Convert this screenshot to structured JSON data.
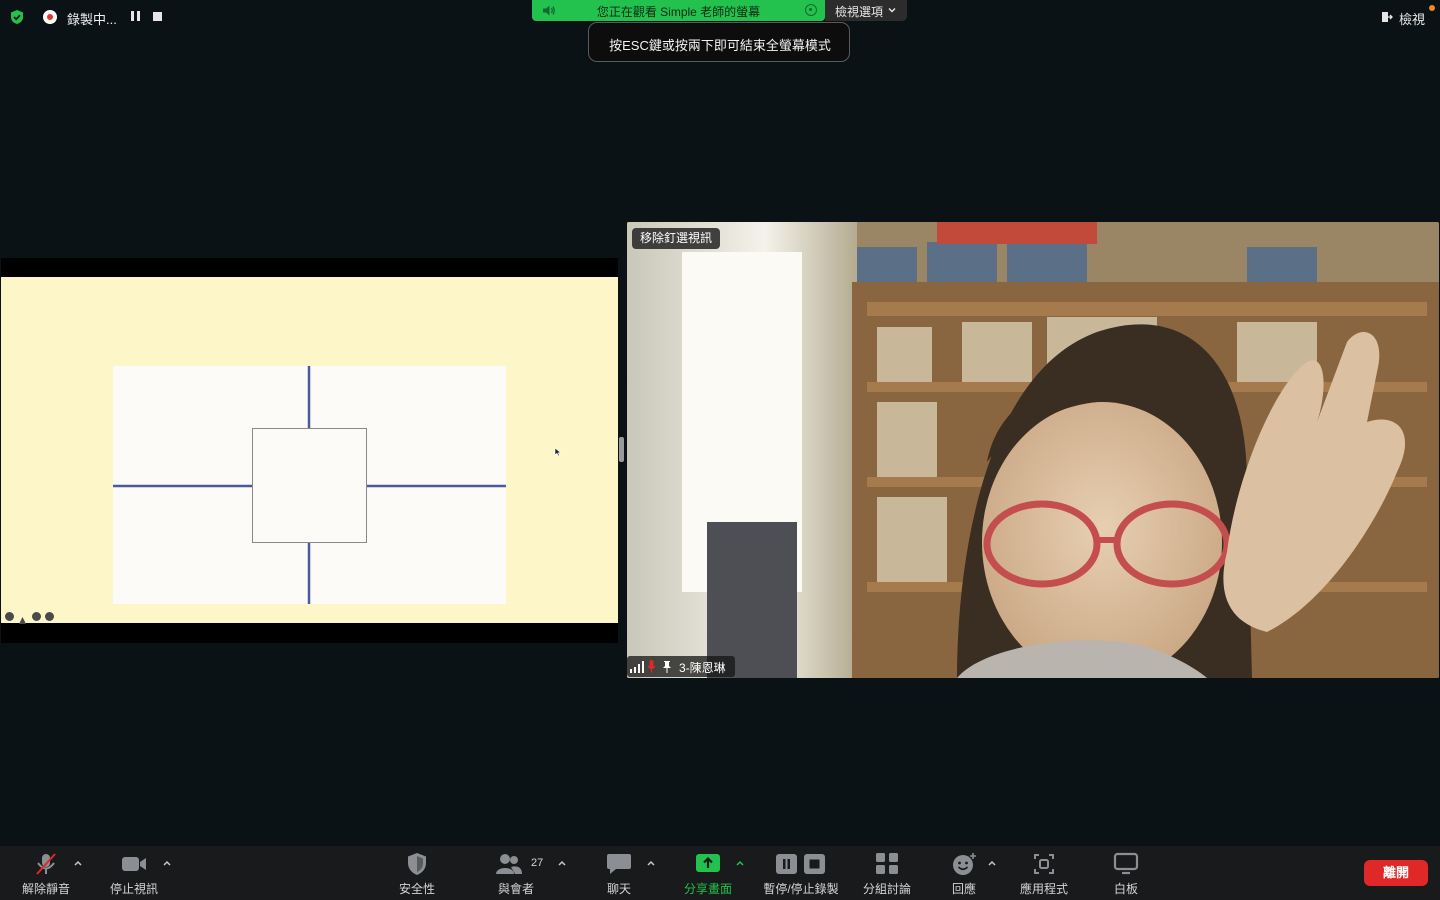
{
  "recording": {
    "label": "錄製中..."
  },
  "banner": {
    "text": "您正在觀看 Simple 老師的螢幕",
    "view_options": "檢視選項"
  },
  "esc_tip": "按ESC鍵或按兩下即可結束全螢幕模式",
  "view_button": "檢視",
  "video": {
    "unpin_label": "移除釘選視訊",
    "participant_name": "3-陳恩琳"
  },
  "toolbar": {
    "unmute": "解除靜音",
    "stop_video": "停止視訊",
    "security": "安全性",
    "participants": "與會者",
    "participant_count": "27",
    "chat": "聊天",
    "share_screen": "分享畫面",
    "pause_stop_recording": "暫停/停止錄製",
    "breakout_rooms": "分組討論",
    "reactions": "回應",
    "apps": "應用程式",
    "whiteboard": "白板",
    "leave": "離開"
  },
  "colors": {
    "banner_green": "#23c14d",
    "leave_red": "#e02828",
    "recording_red": "#e8322e"
  }
}
